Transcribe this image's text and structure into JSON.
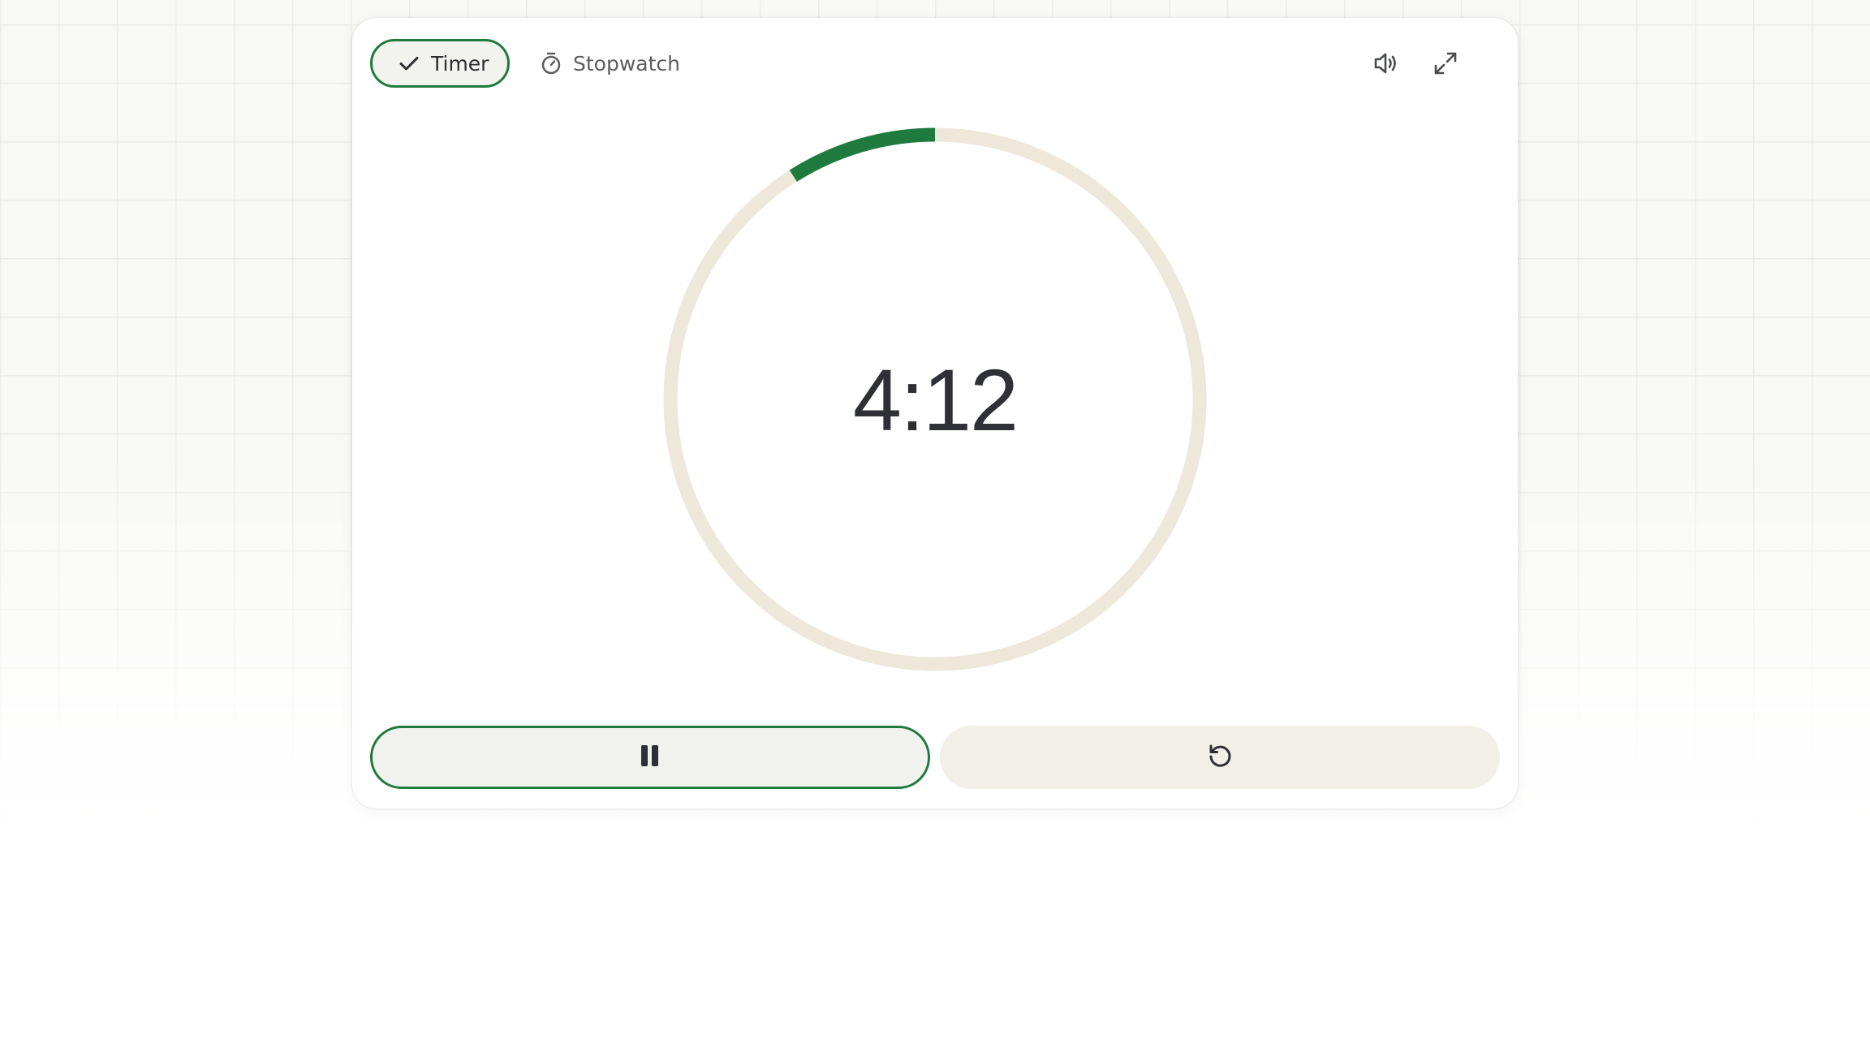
{
  "timer": {
    "mode_tabs": [
      {
        "label": "Timer",
        "icon": "check-icon",
        "selected": true
      },
      {
        "label": "Stopwatch",
        "icon": "stopwatch-icon",
        "selected": false
      }
    ],
    "time_remaining": "4:12",
    "progress_elapsed_fraction": 0.09,
    "header_icons": [
      "volume-icon",
      "expand-icon"
    ],
    "controls": {
      "primary_icon": "pause-icon",
      "secondary_icon": "reset-icon"
    }
  },
  "colors": {
    "accent": "#1f7a3d",
    "ring_track": "#ede8d9",
    "text": "#2f3035",
    "muted_text": "#5c5d60"
  }
}
